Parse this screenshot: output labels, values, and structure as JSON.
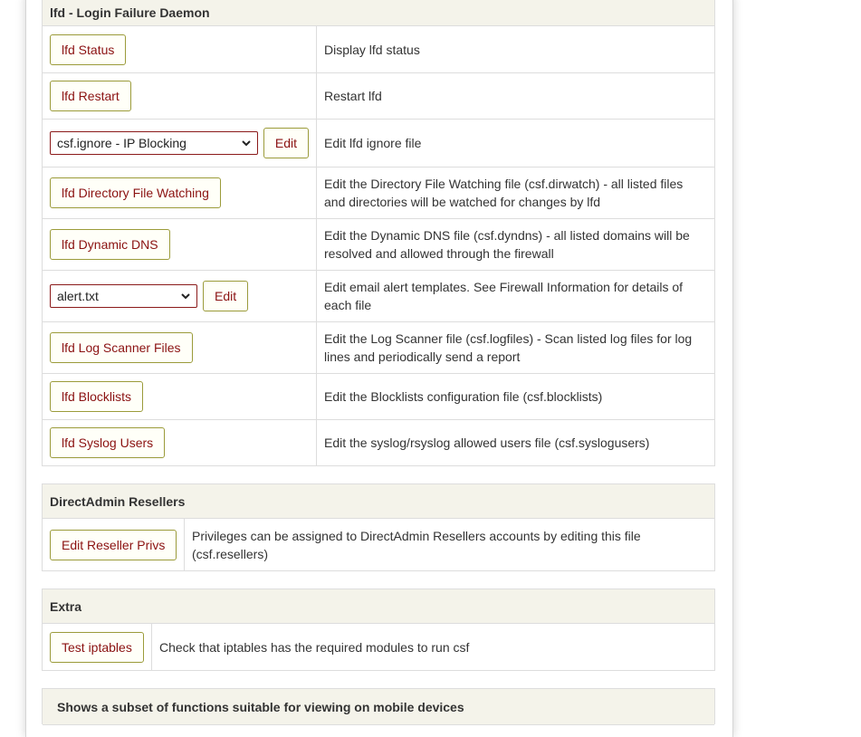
{
  "lfd": {
    "title": "lfd - Login Failure Daemon",
    "rows": [
      {
        "button": "lfd Status",
        "description": "Display lfd status"
      },
      {
        "button": "lfd Restart",
        "description": "Restart lfd"
      },
      {
        "select_value": "csf.ignore - IP Blocking",
        "button": "Edit",
        "description": "Edit lfd ignore file"
      },
      {
        "button": "lfd Directory File Watching",
        "description": "Edit the Directory File Watching file (csf.dirwatch) - all listed files and directories will be watched for changes by lfd"
      },
      {
        "button": "lfd Dynamic DNS",
        "description": "Edit the Dynamic DNS file (csf.dyndns) - all listed domains will be resolved and allowed through the firewall"
      },
      {
        "select_value": "alert.txt",
        "button": "Edit",
        "description": "Edit email alert templates. See Firewall Information for details of each file"
      },
      {
        "button": "lfd Log Scanner Files",
        "description": "Edit the Log Scanner file (csf.logfiles) - Scan listed log files for log lines and periodically send a report"
      },
      {
        "button": "lfd Blocklists",
        "description": "Edit the Blocklists configuration file (csf.blocklists)"
      },
      {
        "button": "lfd Syslog Users",
        "description": "Edit the syslog/rsyslog allowed users file (csf.syslogusers)"
      }
    ]
  },
  "resellers": {
    "title": "DirectAdmin Resellers",
    "button": "Edit Reseller Privs",
    "description": "Privileges can be assigned to DirectAdmin Resellers accounts by editing this file (csf.resellers)"
  },
  "extra": {
    "title": "Extra",
    "button": "Test iptables",
    "description": "Check that iptables has the required modules to run csf"
  },
  "mobile": {
    "title": "Shows a subset of functions suitable for viewing on mobile devices"
  },
  "icons": {
    "dropdown": "chevron-down-icon"
  },
  "colors": {
    "header_bg": "#f4f3ea",
    "button_text": "#8b1212",
    "button_border": "#9b9b3a",
    "select_border": "#8b1a1a"
  }
}
